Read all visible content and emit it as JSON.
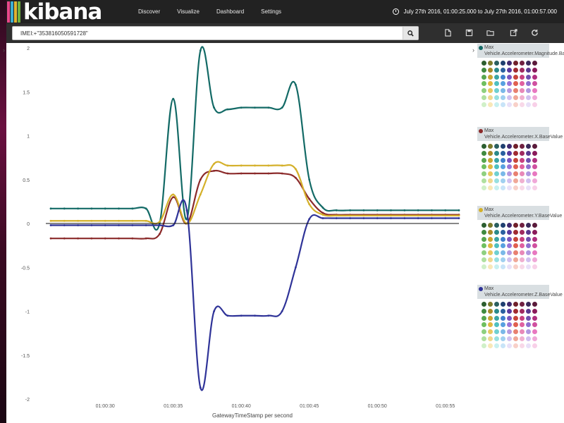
{
  "topnav": {
    "logo_text": "kibana",
    "logo_bar_colors": [
      "#e8488b",
      "#3caed2",
      "#e0b432",
      "#6fb23f"
    ],
    "items": [
      {
        "label": "Discover"
      },
      {
        "label": "Visualize"
      },
      {
        "label": "Dashboard"
      },
      {
        "label": "Settings"
      }
    ],
    "time_range": "July 27th 2016, 01:00:25.000 to July 27th 2016, 01:00:57.000"
  },
  "search": {
    "query": "IMEI:+\"353816050591728\"",
    "button_icon": "search-icon"
  },
  "toolbar": {
    "icons": [
      "new-document-icon",
      "save-icon",
      "open-folder-icon",
      "share-icon",
      "reload-icon"
    ]
  },
  "legend": {
    "items": [
      {
        "label": "Max Vehicle.Accelerometer.Magnitude.BaseValue",
        "color": "#136a66"
      },
      {
        "label": "Max Vehicle.Accelerometer.X.BaseValue",
        "color": "#8b2a2a"
      },
      {
        "label": "Max Vehicle.Accelerometer.Y.BaseValue",
        "color": "#d4b02a"
      },
      {
        "label": "Max Vehicle.Accelerometer.Z.BaseValue",
        "color": "#2f3398"
      }
    ],
    "palette": [
      [
        "#2c5e2f",
        "#7a7a2a",
        "#2a5f5f",
        "#1f3f70",
        "#402a70",
        "#70202a",
        "#702040",
        "#3a2a5a",
        "#5a1a3a"
      ],
      [
        "#3f8a3f",
        "#a58a2a",
        "#2a8a8a",
        "#2a5fa0",
        "#5a3aa0",
        "#a02a30",
        "#a02a60",
        "#5a3a90",
        "#8a1a5a"
      ],
      [
        "#57a64f",
        "#c8a632",
        "#3aa5a5",
        "#3f7fcf",
        "#7a55c0",
        "#c8453a",
        "#c84080",
        "#7050b0",
        "#b03080"
      ],
      [
        "#6fbf5f",
        "#e0b842",
        "#4fc0c0",
        "#58a0e0",
        "#9a75d8",
        "#e06050",
        "#e060a0",
        "#9070d0",
        "#d050a0"
      ],
      [
        "#8fd07f",
        "#e8c862",
        "#6fd0d0",
        "#7ab8e8",
        "#b59ae0",
        "#e88070",
        "#e888b8",
        "#b098e0",
        "#e878c0"
      ],
      [
        "#b0e0a0",
        "#f0d890",
        "#98e0e0",
        "#a0d0f0",
        "#d0c0f0",
        "#f0a898",
        "#f0b0d0",
        "#d0c0f0",
        "#f0a8d8"
      ],
      [
        "#d0f0c8",
        "#f8e8b8",
        "#c8f0f0",
        "#c8e4f8",
        "#e8e0f8",
        "#f8d0c8",
        "#f8d8e8",
        "#e8e0f8",
        "#f8d0e8"
      ]
    ]
  },
  "chart_data": {
    "type": "line",
    "xlabel": "GatewayTimeStamp per second",
    "ylim": [
      -2,
      2
    ],
    "yticks": [
      2,
      1.5,
      1,
      0.5,
      0,
      -0.5,
      -1,
      -1.5,
      -2
    ],
    "ytick_labels": [
      "2",
      "1.5",
      "1",
      "0.5",
      "0",
      "-0.5",
      "-1",
      "-1.5",
      "-2"
    ],
    "xlim": [
      26,
      56
    ],
    "xticks": [
      30,
      35,
      40,
      45,
      50,
      55
    ],
    "xtick_labels": [
      "01:00:30",
      "01:00:35",
      "01:00:40",
      "01:00:45",
      "01:00:50",
      "01:00:55"
    ],
    "x": [
      26,
      27,
      28,
      29,
      30,
      31,
      32,
      33,
      34,
      35,
      36,
      37,
      38,
      39,
      40,
      41,
      42,
      43,
      44,
      45,
      46,
      47,
      48,
      49,
      50,
      51,
      52,
      53,
      54,
      55,
      56
    ],
    "series": [
      {
        "name": "Max Vehicle.Accelerometer.Magnitude.BaseValue",
        "color": "#136a66",
        "values": [
          0.17,
          0.17,
          0.17,
          0.17,
          0.17,
          0.17,
          0.17,
          0.17,
          0.0,
          1.42,
          0.05,
          1.97,
          1.32,
          1.3,
          1.32,
          1.32,
          1.32,
          1.32,
          1.58,
          0.5,
          0.18,
          0.15,
          0.15,
          0.15,
          0.15,
          0.15,
          0.15,
          0.15,
          0.15,
          0.15,
          0.15
        ]
      },
      {
        "name": "Max Vehicle.Accelerometer.X.BaseValue",
        "color": "#8b2a2a",
        "values": [
          -0.17,
          -0.17,
          -0.17,
          -0.17,
          -0.17,
          -0.17,
          -0.17,
          -0.17,
          -0.12,
          0.3,
          0.0,
          0.5,
          0.6,
          0.57,
          0.57,
          0.57,
          0.57,
          0.57,
          0.52,
          0.28,
          0.12,
          0.1,
          0.1,
          0.1,
          0.1,
          0.1,
          0.1,
          0.1,
          0.1,
          0.1,
          0.1
        ]
      },
      {
        "name": "Max Vehicle.Accelerometer.Y.BaseValue",
        "color": "#d4b02a",
        "values": [
          0.03,
          0.03,
          0.03,
          0.03,
          0.03,
          0.03,
          0.03,
          0.03,
          0.02,
          0.33,
          0.0,
          0.33,
          0.68,
          0.66,
          0.66,
          0.66,
          0.66,
          0.66,
          0.62,
          0.22,
          0.1,
          0.09,
          0.09,
          0.09,
          0.09,
          0.09,
          0.09,
          0.09,
          0.09,
          0.09,
          0.09
        ]
      },
      {
        "name": "Max Vehicle.Accelerometer.Z.BaseValue",
        "color": "#2f3398",
        "values": [
          -0.02,
          -0.02,
          -0.02,
          -0.02,
          -0.02,
          -0.02,
          -0.02,
          -0.02,
          -0.02,
          -0.02,
          0.15,
          -1.87,
          -1.0,
          -1.05,
          -1.05,
          -1.05,
          -1.05,
          -1.0,
          -0.5,
          0.05,
          0.06,
          0.06,
          0.06,
          0.06,
          0.06,
          0.06,
          0.06,
          0.06,
          0.06,
          0.06,
          0.06
        ]
      }
    ]
  }
}
